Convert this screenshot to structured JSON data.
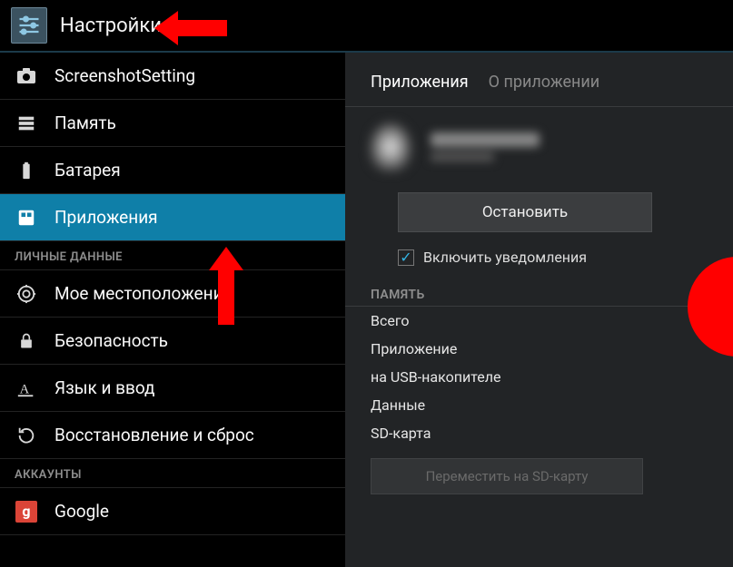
{
  "header": {
    "title": "Настройки"
  },
  "sidebar": {
    "items": [
      {
        "label": "ScreenshotSetting"
      },
      {
        "label": "Память"
      },
      {
        "label": "Батарея"
      },
      {
        "label": "Приложения"
      },
      {
        "label": "Мое местоположение"
      },
      {
        "label": "Безопасность"
      },
      {
        "label": "Язык и ввод"
      },
      {
        "label": "Восстановление и сброс"
      },
      {
        "label": "Google"
      }
    ],
    "section_personal": "ЛИЧНЫЕ ДАННЫЕ",
    "section_accounts": "АККАУНТЫ"
  },
  "content": {
    "tabs": {
      "apps": "Приложения",
      "about": "О приложении"
    },
    "stop_btn": "Остановить",
    "notify_checkbox": "Включить уведомления",
    "storage_header": "ПАМЯТЬ",
    "storage": {
      "total": "Всего",
      "app": "Приложение",
      "usb": "на USB-накопителе",
      "data": "Данные",
      "sd": "SD-карта"
    },
    "move_btn": "Переместить на SD-карту"
  }
}
